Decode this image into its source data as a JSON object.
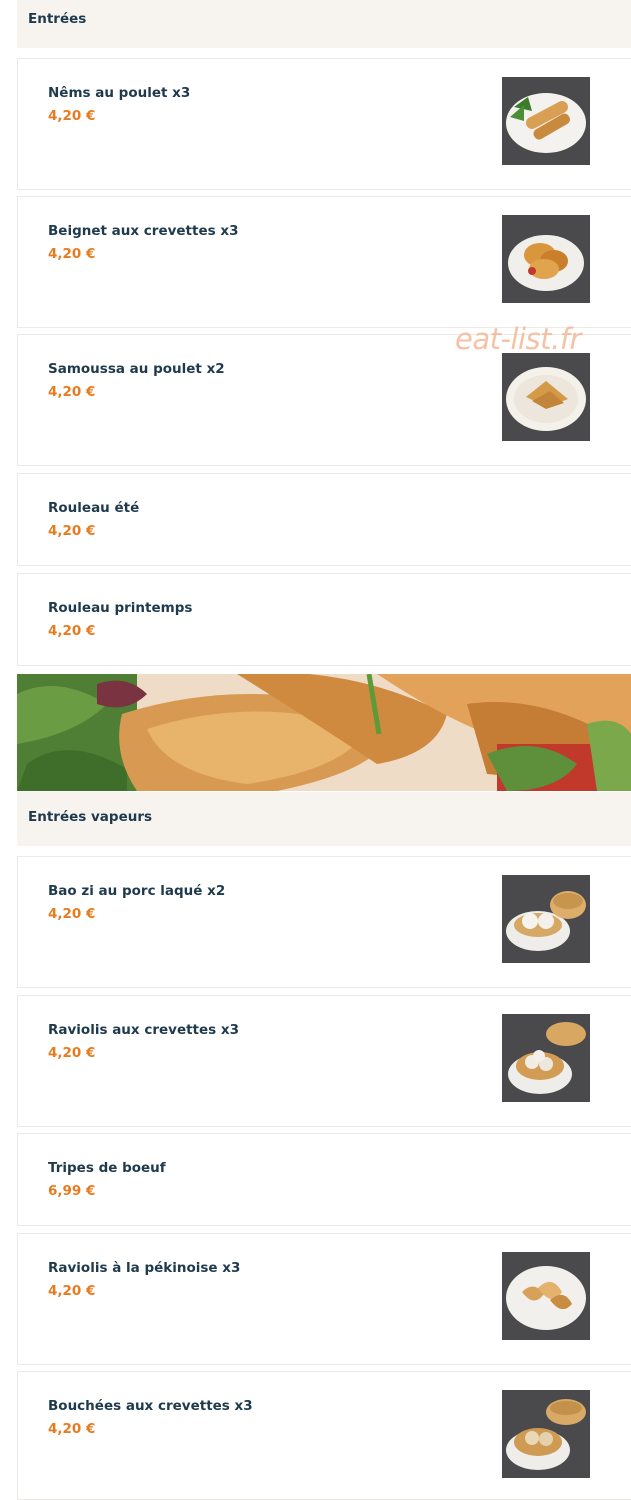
{
  "sections": [
    {
      "title": "Entrées",
      "items": [
        {
          "name": "Nêms au poulet x3",
          "price": "4,20 €",
          "image": "nems-photo"
        },
        {
          "name": "Beignet aux crevettes x3",
          "price": "4,20 €",
          "image": "beignet-photo"
        },
        {
          "name": "Samoussa au poulet x2",
          "price": "4,20 €",
          "image": "samoussa-photo"
        },
        {
          "name": "Rouleau été",
          "price": "4,20 €"
        },
        {
          "name": "Rouleau printemps",
          "price": "4,20 €"
        }
      ]
    },
    {
      "title": "Entrées vapeurs",
      "items": [
        {
          "name": "Bao zi au porc laqué x2",
          "price": "4,20 €",
          "image": "bao-photo"
        },
        {
          "name": "Raviolis aux crevettes x3",
          "price": "4,20 €",
          "image": "raviolis-photo"
        },
        {
          "name": "Tripes de boeuf",
          "price": "6,99 €"
        },
        {
          "name": "Raviolis à la pékinoise x3",
          "price": "4,20 €",
          "image": "pekinoise-photo"
        },
        {
          "name": "Bouchées aux crevettes x3",
          "price": "4,20 €",
          "image": "bouchees-photo"
        }
      ]
    }
  ],
  "watermark": "eat-list.fr",
  "colors": {
    "name": "#1f3a4d",
    "price": "#e77b1f",
    "header_bg": "#f7f3ef"
  }
}
